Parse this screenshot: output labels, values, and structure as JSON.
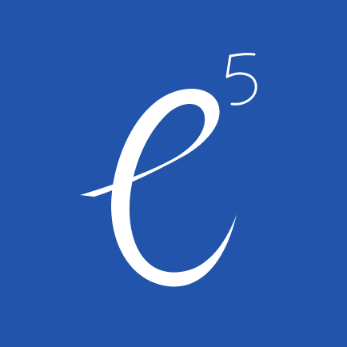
{
  "app_icon": {
    "background_color": "#2154aa",
    "glyph_color": "#ffffff",
    "logo_text": "e5"
  }
}
